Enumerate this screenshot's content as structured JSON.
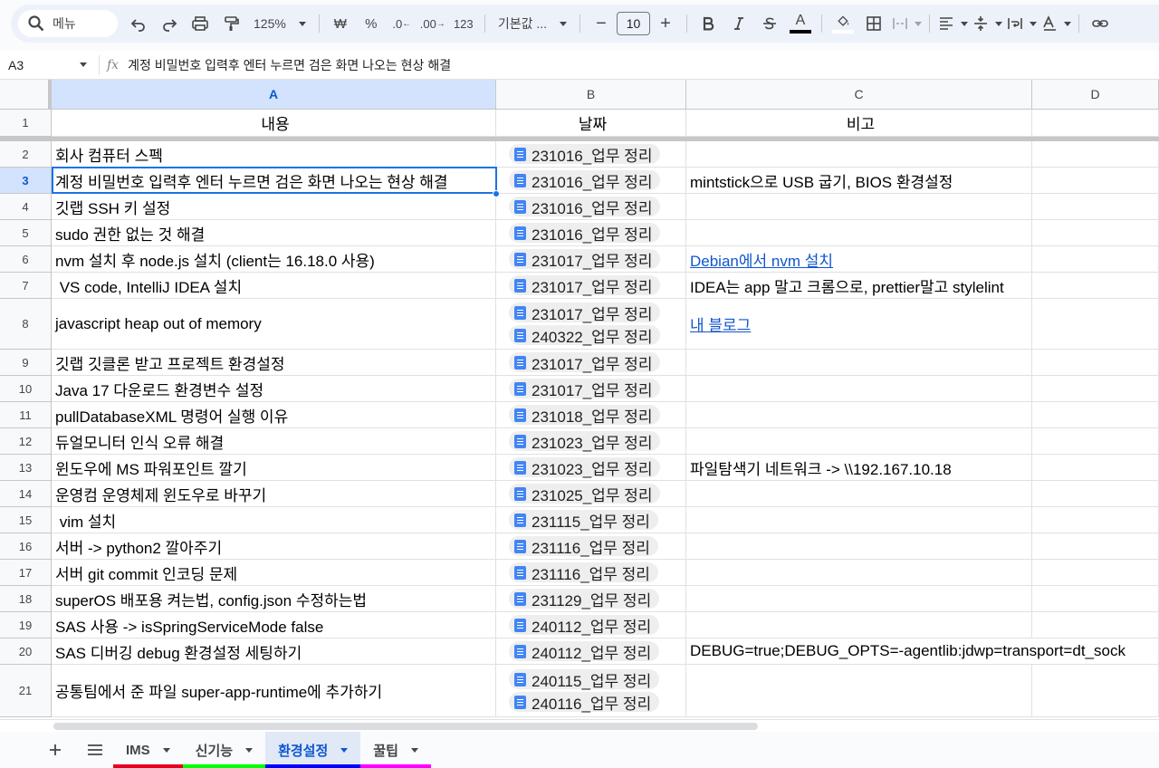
{
  "toolbar": {
    "search_placeholder": "메뉴",
    "zoom": "125%",
    "currency": "₩",
    "percent": "%",
    "decrease_decimal": ".0",
    "increase_decimal": ".00",
    "number_format": "123",
    "font_name": "기본값 ...",
    "font_size": "10",
    "minus": "−",
    "plus": "+"
  },
  "formula_bar": {
    "cell_ref": "A3",
    "content": "계정 비밀번호 입력후 엔터 누르면 검은 화면 나오는 현상 해결"
  },
  "columns": [
    "A",
    "B",
    "C",
    "D"
  ],
  "header_row": {
    "num": "1",
    "a": "내용",
    "b": "날짜",
    "c": "비고"
  },
  "rows": [
    {
      "num": "2",
      "a": "회사 컴퓨터 스펙",
      "dates": [
        "231016_업무 정리"
      ],
      "c": ""
    },
    {
      "num": "3",
      "a": "계정 비밀번호 입력후 엔터 누르면 검은 화면 나오는 현상 해결",
      "dates": [
        "231016_업무 정리"
      ],
      "c": "mintstick으로 USB 굽기, BIOS 환경설정"
    },
    {
      "num": "4",
      "a": "깃랩 SSH 키 설정",
      "dates": [
        "231016_업무 정리"
      ],
      "c": ""
    },
    {
      "num": "5",
      "a": "sudo 권한 없는 것 해결",
      "dates": [
        "231016_업무 정리"
      ],
      "c": ""
    },
    {
      "num": "6",
      "a": "nvm 설치 후 node.js 설치 (client는 16.18.0 사용)",
      "dates": [
        "231017_업무 정리"
      ],
      "c": "Debian에서 nvm 설치",
      "c_link": true
    },
    {
      "num": "7",
      "a": " VS code, IntelliJ IDEA 설치",
      "dates": [
        "231017_업무 정리"
      ],
      "c": "IDEA는 app 말고 크롬으로, prettier말고 stylelint"
    },
    {
      "num": "8",
      "a": "javascript heap out of memory",
      "dates": [
        "231017_업무 정리",
        "240322_업무 정리"
      ],
      "c": "내 블로그",
      "c_link": true
    },
    {
      "num": "9",
      "a": "깃랩 깃클론 받고 프로젝트 환경설정",
      "dates": [
        "231017_업무 정리"
      ],
      "c": ""
    },
    {
      "num": "10",
      "a": "Java 17 다운로드 환경변수 설정",
      "dates": [
        "231017_업무 정리"
      ],
      "c": ""
    },
    {
      "num": "11",
      "a": "pullDatabaseXML 명령어 실행 이유",
      "dates": [
        "231018_업무 정리"
      ],
      "c": ""
    },
    {
      "num": "12",
      "a": "듀얼모니터 인식 오류 해결",
      "dates": [
        "231023_업무 정리"
      ],
      "c": ""
    },
    {
      "num": "13",
      "a": "윈도우에 MS 파워포인트 깔기",
      "dates": [
        "231023_업무 정리"
      ],
      "c": "파일탐색기 네트워크 -> \\\\192.167.10.18"
    },
    {
      "num": "14",
      "a": "운영컴 운영체제 윈도우로 바꾸기",
      "dates": [
        "231025_업무 정리"
      ],
      "c": ""
    },
    {
      "num": "15",
      "a": " vim 설치",
      "dates": [
        "231115_업무 정리"
      ],
      "c": ""
    },
    {
      "num": "16",
      "a": "서버 -> python2 깔아주기",
      "dates": [
        "231116_업무 정리"
      ],
      "c": ""
    },
    {
      "num": "17",
      "a": "서버 git commit 인코딩 문제",
      "dates": [
        "231116_업무 정리"
      ],
      "c": ""
    },
    {
      "num": "18",
      "a": "superOS 배포용 켜는법, config.json 수정하는법",
      "dates": [
        "231129_업무 정리"
      ],
      "c": ""
    },
    {
      "num": "19",
      "a": "SAS 사용 -> isSpringServiceMode false",
      "dates": [
        "240112_업무 정리"
      ],
      "c": ""
    },
    {
      "num": "20",
      "a": "SAS 디버깅 debug 환경설정 세팅하기",
      "dates": [
        "240112_업무 정리"
      ],
      "c": "DEBUG=true;DEBUG_OPTS=-agentlib:jdwp=transport=dt_sock",
      "c_overflow": true
    },
    {
      "num": "21",
      "a": "공통팀에서 준 파일 super-app-runtime에 추가하기",
      "dates": [
        "240115_업무 정리",
        "240116_업무 정리"
      ],
      "c": ""
    }
  ],
  "selected_row": "3",
  "sheet_tabs": [
    {
      "label": "IMS",
      "color": "#e6001f",
      "active": false
    },
    {
      "label": "신기능",
      "color": "#00ff00",
      "active": false
    },
    {
      "label": "환경설정",
      "color": "#0000ff",
      "active": true
    },
    {
      "label": "꿀팁",
      "color": "#ff00ff",
      "active": false
    }
  ]
}
